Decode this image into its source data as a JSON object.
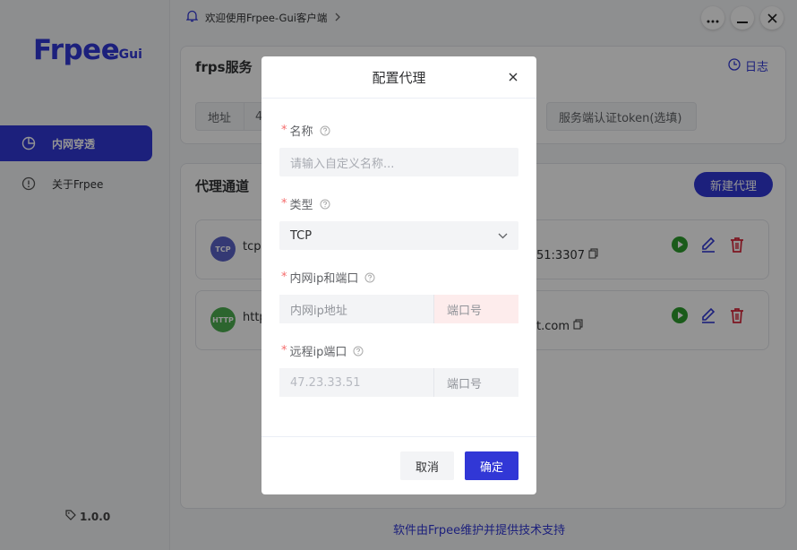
{
  "app": {
    "logo": "Frpee",
    "logo_sub": "- Gui",
    "version": "1.0.0"
  },
  "sidebar": {
    "items": [
      {
        "label": "内网穿透",
        "icon": "pie-chart-icon",
        "active": true
      },
      {
        "label": "关于Frpee",
        "icon": "info-circle-icon",
        "active": false
      }
    ]
  },
  "topbar": {
    "notice": "欢迎使用Frpee-Gui客户端",
    "window_buttons": [
      "more-icon",
      "minimize-icon",
      "close-icon"
    ]
  },
  "frps_card": {
    "title": "frps服务",
    "log_label": "日志",
    "address_label": "地址",
    "address_partial": "4",
    "token_placeholder": "服务端认证token(选填)"
  },
  "proxy_card": {
    "title": "代理通道",
    "new_button": "新建代理",
    "items": [
      {
        "badge": "TCP",
        "badge_color": "#5b63c8",
        "name": "tcp",
        "address": "51:3307"
      },
      {
        "badge": "HTTP",
        "badge_color": "#4caf50",
        "name": "http",
        "address": "t.com"
      }
    ]
  },
  "footer": {
    "link": "软件由Frpee维护并提供技术支持"
  },
  "dialog": {
    "title": "配置代理",
    "fields": {
      "name": {
        "label": "名称",
        "placeholder": "请输入自定义名称..."
      },
      "type": {
        "label": "类型",
        "value": "TCP"
      },
      "local": {
        "label": "内网ip和端口",
        "ip_placeholder": "内网ip地址",
        "port_placeholder": "端口号"
      },
      "remote": {
        "label": "远程ip端口",
        "ip_value": "47.23.33.51",
        "port_placeholder": "端口号"
      }
    },
    "cancel": "取消",
    "confirm": "确定"
  },
  "colors": {
    "accent": "#3137d6",
    "danger": "#f56c6c",
    "play": "#2e9e2e",
    "delete": "#d8263a"
  }
}
